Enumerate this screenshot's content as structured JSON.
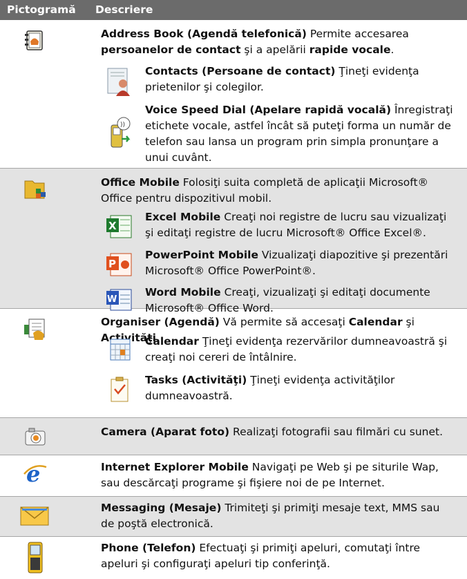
{
  "header": {
    "col1": "Pictogramă",
    "col2": "Descriere"
  },
  "address_book": {
    "t1": "Address Book (Agendă telefonică)",
    "t2": "  Permite accesarea ",
    "t3": "persoanelor de contact",
    "t4": " şi a apelării ",
    "t5": "rapide vocale",
    "t6": ".",
    "contacts_title": "Contacts  (Persoane de contact)",
    "contacts_desc": "  Ţineţi evidenţa prietenilor şi colegilor.",
    "voice_title": "Voice Speed Dial (Apelare rapidă vocală)",
    "voice_desc": " Înregistraţi etichete vocale, astfel încât să puteţi forma un număr de telefon sau lansa un program prin simpla pronunţare a unui cuvânt."
  },
  "office": {
    "title": "Office Mobile",
    "desc": "  Folosiţi suita completă de aplicaţii Microsoft® Office pentru dispozitivul mobil.",
    "excel_title": "Excel Mobile",
    "excel_desc": " Creaţi noi registre de lucru sau vizualizaţi şi editaţi registre de lucru Microsoft® Office Excel®.",
    "ppt_title": "PowerPoint Mobile",
    "ppt_desc": " Vizualizaţi diapozitive şi prezentări Microsoft® Office PowerPoint®.",
    "word_title": "Word Mobile",
    "word_desc": " Creaţi, vizualizaţi şi editaţi documente Microsoft® Office Word."
  },
  "organiser": {
    "t1": "Organiser (Agendă)",
    "t2": "   Vă permite să accesaţi ",
    "t3": "Calendar",
    "t4": " şi ",
    "t5": "Activităţi",
    "t6": ".",
    "cal_title": "Calendar",
    "cal_desc": " Ţineţi evidenţa rezervărilor dumneavoastră şi creaţi noi cereri de întâlnire.",
    "tasks_title": "Tasks (Activităţi)",
    "tasks_desc": "  Ţineţi evidenţa activităţilor dumneavoastră."
  },
  "camera": {
    "title": "Camera (Aparat foto)",
    "desc": "   Realizaţi fotografii sau filmări cu sunet."
  },
  "ie": {
    "title": "Internet Explorer Mobile",
    "desc": "  Navigaţi pe Web şi pe siturile Wap, sau descărcaţi programe şi fişiere noi de pe Internet."
  },
  "messaging": {
    "title": "Messaging (Mesaje)",
    "desc": "   Trimiteţi şi primiţi mesaje text, MMS sau de poştă electronică."
  },
  "phone": {
    "title": "Phone (Telefon)",
    "desc": "  Efectuaţi şi primiţi apeluri, comutaţi între apeluri şi configuraţi apeluri tip conferinţă."
  }
}
